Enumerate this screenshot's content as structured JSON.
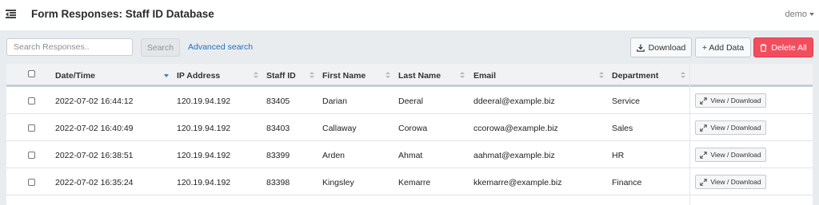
{
  "header": {
    "title": "Form Responses: Staff ID Database",
    "user": "demo"
  },
  "toolbar": {
    "search_placeholder": "Search Responses..",
    "search_label": "Search",
    "advanced_search_label": "Advanced search",
    "download_label": "Download",
    "add_data_label": "+ Add Data",
    "delete_all_label": "Delete All",
    "delete_color": "#f04e5e",
    "link_color": "#1f6fb8"
  },
  "table": {
    "columns": [
      "Date/Time",
      "IP Address",
      "Staff ID",
      "First Name",
      "Last Name",
      "Email",
      "Department"
    ],
    "sorted_column": "Date/Time",
    "sort_direction": "descending",
    "view_label": "View / Download",
    "rows": [
      {
        "datetime": "2022-07-02 16:44:12",
        "ip": "120.19.94.192",
        "staff_id": "83405",
        "first_name": "Darian",
        "last_name": "Deeral",
        "email": "ddeeral@example.biz",
        "department": "Service"
      },
      {
        "datetime": "2022-07-02 16:40:49",
        "ip": "120.19.94.192",
        "staff_id": "83403",
        "first_name": "Callaway",
        "last_name": "Corowa",
        "email": "ccorowa@example.biz",
        "department": "Sales"
      },
      {
        "datetime": "2022-07-02 16:38:51",
        "ip": "120.19.94.192",
        "staff_id": "83399",
        "first_name": "Arden",
        "last_name": "Ahmat",
        "email": "aahmat@example.biz",
        "department": "HR"
      },
      {
        "datetime": "2022-07-02 16:35:24",
        "ip": "120.19.94.192",
        "staff_id": "83398",
        "first_name": "Kingsley",
        "last_name": "Kemarre",
        "email": "kkemarre@example.biz",
        "department": "Finance"
      }
    ]
  }
}
